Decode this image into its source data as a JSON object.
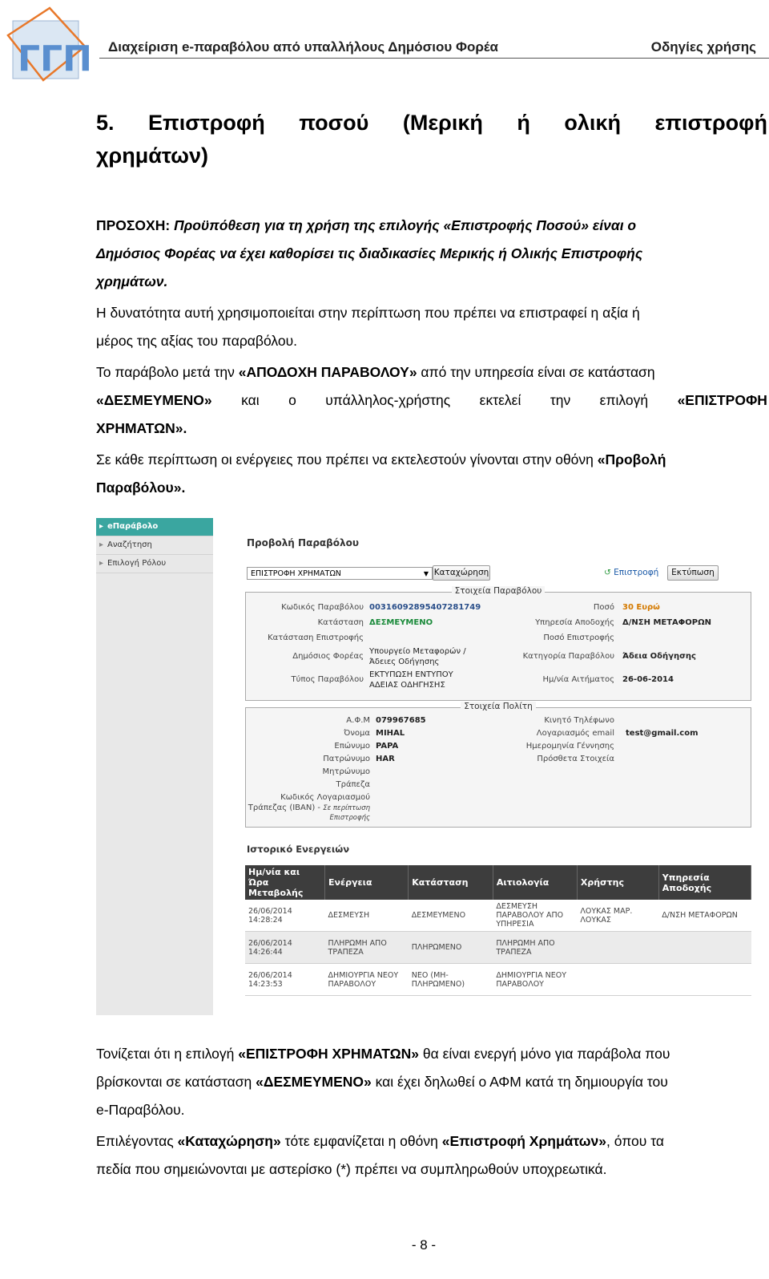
{
  "header": {
    "left": "Διαχείριση e-παραβόλου από υπαλλήλους Δημόσιου Φορέα",
    "right": "Οδηγίες χρήσης",
    "logo_text": "ΓΓΠΣ"
  },
  "section": {
    "title_line1_parts": [
      "5.",
      "Επιστροφή",
      "ποσού",
      "(Μερική",
      "ή",
      "ολική",
      "επιστροφή"
    ],
    "title_line2": "χρημάτων)"
  },
  "warning": {
    "label": "ΠΡΟΣΟΧΗ:",
    "line1": "Προϋπόθεση για τη χρήση της επιλογής «Επιστροφής Ποσού» είναι ο",
    "line2": "Δημόσιος Φορέας να έχει καθορίσει τις διαδικασίες Μερικής ή Ολικής Επιστροφής",
    "line3": "χρημάτων."
  },
  "paragraphs": {
    "p1_line1": "Η δυνατότητα αυτή χρησιμοποιείται στην περίπτωση που πρέπει να επιστραφεί η αξία ή",
    "p1_line2": "μέρος της αξίας του παραβόλου.",
    "p2_a": "Το παράβολο μετά την ",
    "p2_b": "«ΑΠΟΔΟΧΗ ΠΑΡΑΒΟΛΟΥ»",
    "p2_c": " από την υπηρεσία  είναι σε κατάσταση",
    "p2_l2_a": "«ΔΕΣΜΕΥΜΕΝΟ»",
    "p2_l2_words": [
      "και",
      "ο",
      "υπάλληλος-χρήστης",
      "εκτελεί",
      "την",
      "επιλογή"
    ],
    "p2_l2_b": "«ΕΠΙΣΤΡΟΦΗ",
    "p2_l3": "ΧΡΗΜΑΤΩΝ».",
    "p3_line1_a": "Σε κάθε περίπτωση οι ενέργειες που πρέπει να εκτελεστούν γίνονται στην οθόνη ",
    "p3_line1_b": "«Προβολή",
    "p3_line2": "Παραβόλου».",
    "p4_a": "Τονίζεται ότι η επιλογή ",
    "p4_b": "«ΕΠΙΣΤΡΟΦΗ ΧΡΗΜΑΤΩΝ»",
    "p4_c": " θα είναι ενεργή μόνο για παράβολα που",
    "p4_l2_a": "βρίσκονται σε κατάσταση ",
    "p4_l2_b": "«ΔΕΣΜΕΥΜΕΝΟ»",
    "p4_l2_c": " και έχει δηλωθεί ο ΑΦΜ κατά τη δημιουργία του",
    "p4_l3": "e-Παραβόλου.",
    "p5_a": "Επιλέγοντας ",
    "p5_b": "«Καταχώρηση»",
    "p5_c": " τότε εμφανίζεται η οθόνη ",
    "p5_d": "«Επιστροφή Χρημάτων»",
    "p5_e": ", όπου τα",
    "p5_l2": "πεδία που σημειώνονται με αστερίσκο (*) πρέπει να συμπληρωθούν υποχρεωτικά."
  },
  "screenshot": {
    "sidebar": [
      "eΠαράβολο",
      "Αναζήτηση",
      "Επιλογή Ρόλου"
    ],
    "title": "Προβολή Παραβόλου",
    "select_value": "ΕΠΙΣΤΡΟΦΗ ΧΡΗΜΑΤΩΝ",
    "register_button": "Καταχώρηση",
    "return_link": "Επιστροφή",
    "print_button": "Εκτύπωση",
    "fee_legend": "Στοιχεία Παραβόλου",
    "fee": {
      "code_label": "Κωδικός Παραβόλου",
      "code": "00316092895407281749",
      "status_label": "Κατάσταση",
      "status": "ΔΕΣΜΕΥΜΕΝΟ",
      "refund_status_label": "Κατάσταση Επιστροφής",
      "org_label": "Δημόσιος Φορέας",
      "org_line1": "Υπουργείο Μεταφορών /",
      "org_line2": "Άδειες Οδήγησης",
      "type_label": "Τύπος Παραβόλου",
      "type_line1": "ΕΚΤΥΠΩΣΗ ΕΝΤΥΠΟΥ",
      "type_line2": "ΑΔΕΙΑΣ ΟΔΗΓΗΣΗΣ",
      "amount_label": "Ποσό",
      "amount": "30 Ευρώ",
      "service_label": "Υπηρεσία Αποδοχής",
      "service": "Δ/ΝΣΗ ΜΕΤΑΦΟΡΩΝ",
      "refund_amount_label": "Ποσό Επιστροφής",
      "category_label": "Κατηγορία Παραβόλου",
      "category": "Άδεια Οδήγησης",
      "date_label": "Ημ/νία Αιτήματος",
      "date": "26-06-2014"
    },
    "citizen_legend": "Στοιχεία Πολίτη",
    "citizen": {
      "afm_label": "Α.Φ.Μ",
      "afm": "079967685",
      "name_label": "Όνομα",
      "name": "MIHAL",
      "surname_label": "Επώνυμο",
      "surname": "PAPA",
      "father_label": "Πατρώνυμο",
      "father": "HAR",
      "mother_label": "Μητρώνυμο",
      "bank_label": "Τράπεζα",
      "iban_label1": "Κωδικός Λογαριασμού",
      "iban_label2": "Τράπεζας (IBAN) - ",
      "iban_note1": "Σε περίπτωση",
      "iban_note2": "Επιστροφής",
      "mobile_label": "Κινητό Τηλέφωνο",
      "email_label": "Λογαριασμός email",
      "email": "test@gmail.com",
      "dob_label": "Ημερομηνία Γέννησης",
      "extra_label": "Πρόσθετα Στοιχεία"
    },
    "history_title": "Ιστορικό Ενεργειών",
    "history_headers": [
      "Ημ/νία και Ώρα Μεταβολής",
      "Ενέργεια",
      "Κατάσταση",
      "Αιτιολογία",
      "Χρήστης",
      "Υπηρεσία Αποδοχής"
    ],
    "history_rows": [
      [
        "26/06/2014 14:28:24",
        "ΔΕΣΜΕΥΣΗ",
        "ΔΕΣΜΕΥΜΕΝΟ",
        "ΔΕΣΜΕΥΣΗ ΠΑΡΑΒΟΛΟΥ ΑΠΟ ΥΠΗΡΕΣΙΑ",
        "ΛΟΥΚΑΣ ΜΑΡ. ΛΟΥΚΑΣ",
        "Δ/ΝΣΗ ΜΕΤΑΦΟΡΩΝ"
      ],
      [
        "26/06/2014 14:26:44",
        "ΠΛΗΡΩΜΗ ΑΠΟ ΤΡΑΠΕΖΑ",
        "ΠΛΗΡΩΜΕΝΟ",
        "ΠΛΗΡΩΜΗ ΑΠΟ ΤΡΑΠΕΖΑ",
        "",
        ""
      ],
      [
        "26/06/2014 14:23:53",
        "ΔΗΜΙΟΥΡΓΙΑ ΝΕΟΥ ΠΑΡΑΒΟΛΟΥ",
        "ΝΕΟ (ΜΗ-ΠΛΗΡΩΜΕΝΟ)",
        "ΔΗΜΙΟΥΡΓΙΑ ΝΕΟΥ ΠΑΡΑΒΟΛΟΥ",
        "",
        ""
      ]
    ]
  },
  "footer": {
    "page": "- 8 -"
  }
}
